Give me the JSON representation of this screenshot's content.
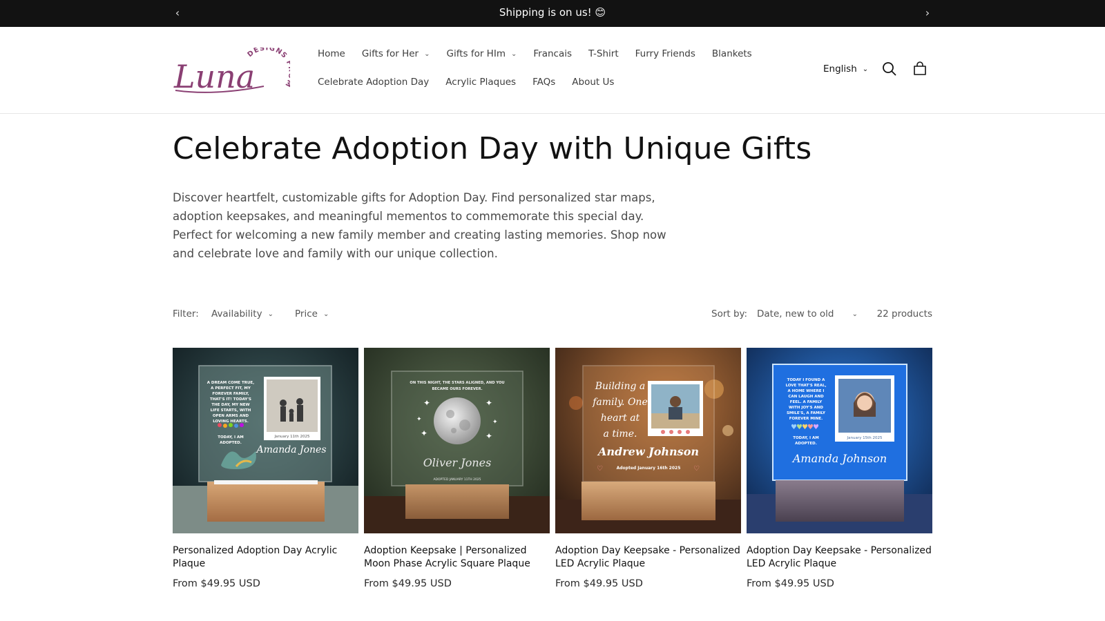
{
  "announcement": {
    "message": "Shipping is on us! 😊"
  },
  "brand": {
    "logo_name": "Luna",
    "logo_tag": "DESIGNS FROM",
    "logo_color": "#8a3f73"
  },
  "nav": {
    "row1": [
      {
        "label": "Home",
        "dropdown": false
      },
      {
        "label": "Gifts for Her",
        "dropdown": true
      },
      {
        "label": "Gifts for HIm",
        "dropdown": true
      },
      {
        "label": "Francais",
        "dropdown": false
      },
      {
        "label": "T-Shirt",
        "dropdown": false
      },
      {
        "label": "Furry Friends",
        "dropdown": false
      },
      {
        "label": "Blankets",
        "dropdown": false
      }
    ],
    "row2": [
      {
        "label": "Celebrate Adoption Day",
        "dropdown": false
      },
      {
        "label": "Acrylic Plaques",
        "dropdown": false
      },
      {
        "label": "FAQs",
        "dropdown": false
      },
      {
        "label": "About Us",
        "dropdown": false
      }
    ]
  },
  "header": {
    "language": "English",
    "icons": [
      "search-icon",
      "cart-icon"
    ]
  },
  "collection": {
    "title": "Celebrate Adoption Day with Unique Gifts",
    "description": "Discover heartfelt, customizable gifts for Adoption Day. Find personalized star maps, adoption keepsakes, and meaningful mementos to commemorate this special day. Perfect for welcoming a new family member and creating lasting memories. Shop now and celebrate love and family with our unique collection."
  },
  "filters": {
    "label": "Filter:",
    "facets": [
      "Availability",
      "Price"
    ],
    "sort_label": "Sort by:",
    "sort_value": "Date, new to old",
    "count": "22 products"
  },
  "products": [
    {
      "title": "Personalized Adoption Day Acrylic Plaque",
      "price": "From $49.95 USD",
      "plaque_name": "Amanda Jones",
      "plaque_text": [
        "A DREAM COME TRUE,",
        "A PERFECT FIT, MY",
        "FOREVER FAMILY,",
        "THAT'S IT! TODAY'S",
        "THE DAY, MY NEW",
        "LIFE STARTS, WITH",
        "OPEN ARMS AND",
        "LOVING HEARTS."
      ],
      "plaque_footer": [
        "TODAY, I AM",
        "ADOPTED."
      ],
      "photo_date": "January 11th 2025"
    },
    {
      "title": "Adoption Keepsake | Personalized Moon Phase Acrylic Square Plaque",
      "price": "From $49.95 USD",
      "plaque_name": "Oliver Jones",
      "plaque_text": [
        "ON THIS NIGHT, THE STARS ALIGNED, AND YOU",
        "BECAME OURS FOREVER."
      ],
      "plaque_footer": [
        "ADOPTED JANUARY 11TH 2025"
      ]
    },
    {
      "title": "Adoption Day Keepsake - Personalized LED Acrylic Plaque",
      "price": "From $49.95 USD",
      "plaque_name": "Andrew Johnson",
      "plaque_text": [
        "Building a",
        "family. One",
        "heart at",
        "a time."
      ],
      "plaque_footer": [
        "Adopted January 16th 2025"
      ]
    },
    {
      "title": "Adoption Day Keepsake - Personalized LED Acrylic Plaque",
      "price": "From $49.95 USD",
      "plaque_name": "Amanda Johnson",
      "plaque_text": [
        "TODAY I FOUND A",
        "LOVE THAT'S REAL,",
        "A HOME WHERE I",
        "CAN LAUGH AND",
        "FEEL. A FAMILY",
        "WITH JOY'S AND",
        "SMILE'S, A FAMILY",
        "FOREVER MINE."
      ],
      "plaque_footer": [
        "TODAY, I AM",
        "ADOPTED."
      ],
      "photo_date": "January 15th 2025"
    }
  ]
}
